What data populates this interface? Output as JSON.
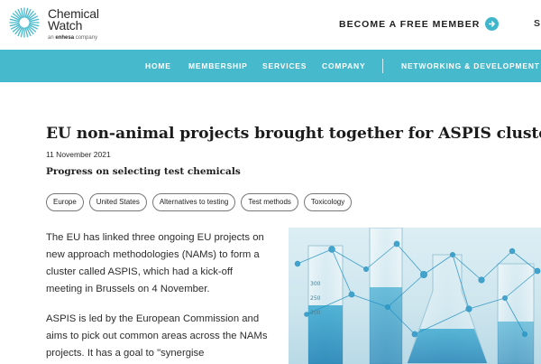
{
  "brand": {
    "name_line1": "Chemical",
    "name_line2": "Watch",
    "tagline_prefix": "an",
    "tagline_brand": "enhesa",
    "tagline_suffix": "company",
    "accent_color": "#47b9cd",
    "logo_icon": "sunburst-logo-icon"
  },
  "header": {
    "cta_label": "BECOME A FREE MEMBER",
    "cta_icon": "arrow-right-circle-icon",
    "cut_label": "S"
  },
  "nav": {
    "items": [
      "HOME",
      "MEMBERSHIP",
      "SERVICES",
      "COMPANY"
    ],
    "secondary": "NETWORKING & DEVELOPMENT"
  },
  "article": {
    "title": "EU non-animal projects brought together for ASPIS cluster",
    "date": "11 November 2021",
    "subtitle": "Progress on selecting test chemicals",
    "tags": [
      "Europe",
      "United States",
      "Alternatives to testing",
      "Test methods",
      "Toxicology"
    ],
    "paragraphs": [
      "The EU has linked three ongoing EU projects on new approach methodologies (NAMs) to form a cluster called ASPIS, which had a kick-off meeting in Brussels on 4 November.",
      "ASPIS is led by the European Commission and aims to pick out common areas across the NAMs projects. It has a goal to \"synergise"
    ],
    "image_marks": [
      "300",
      "250",
      "200"
    ]
  }
}
